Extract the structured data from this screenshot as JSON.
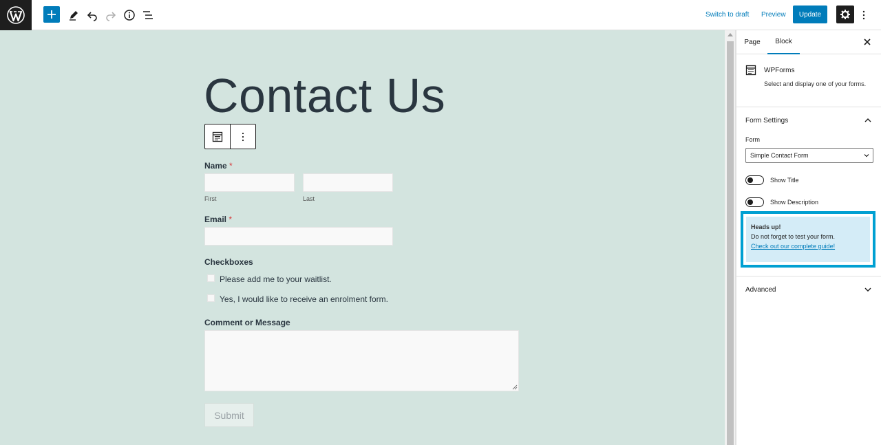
{
  "toolbar": {
    "switch_to_draft": "Switch to draft",
    "preview": "Preview",
    "update": "Update"
  },
  "icons": {
    "logo": "wordpress-logo",
    "add": "plus-icon",
    "edit": "pencil-icon",
    "undo": "undo-icon",
    "redo": "redo-icon",
    "info": "info-icon",
    "outline": "list-view-icon",
    "settings": "gear-icon",
    "more": "more-vertical-icon"
  },
  "colors": {
    "accent": "#007cba",
    "canvas_bg": "#d3e4df",
    "notice_border": "#00a0d2",
    "notice_bg": "#d4ecf7"
  },
  "page": {
    "title": "Contact Us"
  },
  "form": {
    "name_label": "Name",
    "required_mark": "*",
    "first_label": "First",
    "last_label": "Last",
    "email_label": "Email",
    "checkboxes_label": "Checkboxes",
    "checkbox_options": [
      "Please add me to your waitlist.",
      "Yes, I would like to receive an enrolment form."
    ],
    "comment_label": "Comment or Message",
    "submit_label": "Submit"
  },
  "sidebar": {
    "tabs": [
      "Page",
      "Block"
    ],
    "active_tab": "Block",
    "block_name": "WPForms",
    "block_description": "Select and display one of your forms.",
    "form_settings_title": "Form Settings",
    "form_field_label": "Form",
    "form_selected": "Simple Contact Form",
    "show_title_label": "Show Title",
    "show_description_label": "Show Description",
    "notice_title": "Heads up!",
    "notice_text": "Do not forget to test your form.",
    "notice_link": "Check out our complete guide!",
    "advanced_title": "Advanced"
  }
}
